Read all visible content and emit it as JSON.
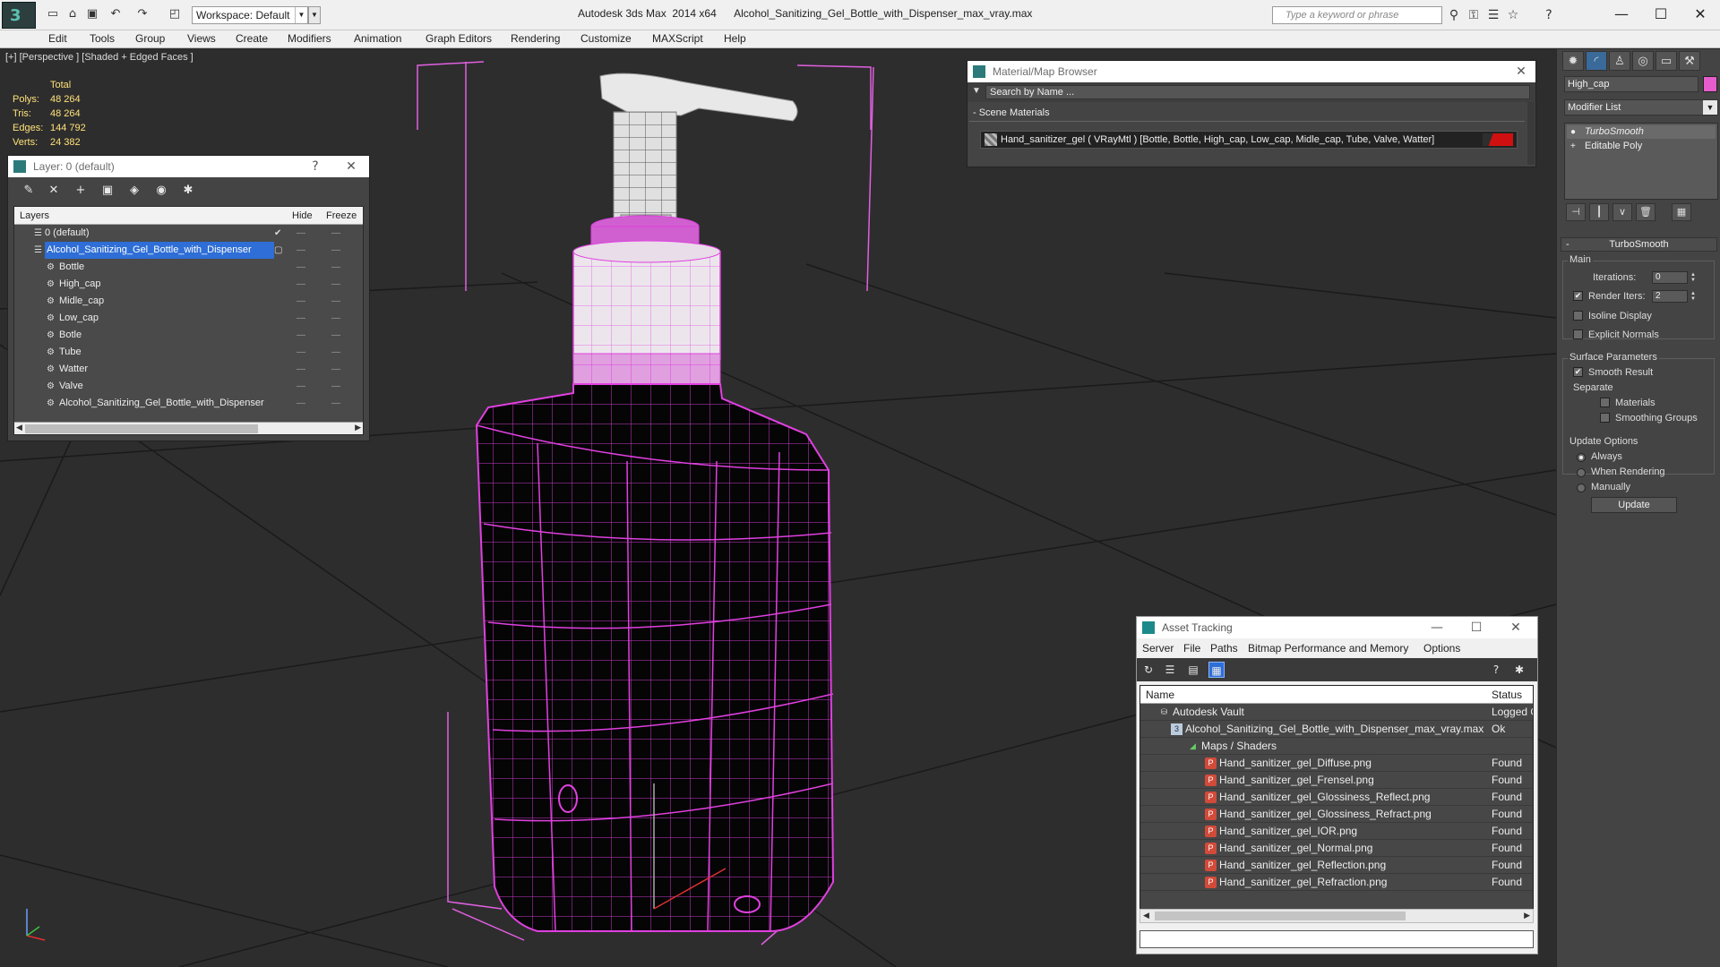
{
  "titlebar": {
    "workspace": "Workspace: Default",
    "app_title": "Autodesk 3ds Max  2014 x64      Alcohol_Sanitizing_Gel_Bottle_with_Dispenser_max_vray.max",
    "search_placeholder": "Type a keyword or phrase"
  },
  "menu": [
    "Edit",
    "Tools",
    "Group",
    "Views",
    "Create",
    "Modifiers",
    "Animation",
    "Graph Editors",
    "Rendering",
    "Customize",
    "MAXScript",
    "Help"
  ],
  "viewport": {
    "label": "[+] [Perspective ] [Shaded + Edged Faces ]",
    "stats": {
      "header": "Total",
      "rows": [
        {
          "k": "Polys:",
          "v": "48 264"
        },
        {
          "k": "Tris:",
          "v": "48 264"
        },
        {
          "k": "Edges:",
          "v": "144 792"
        },
        {
          "k": "Verts:",
          "v": "24 382"
        }
      ]
    }
  },
  "layer_window": {
    "title": "Layer: 0 (default)",
    "help": "?",
    "columns": {
      "layers": "Layers",
      "hide": "Hide",
      "freeze": "Freeze"
    },
    "rows": [
      {
        "name": "0 (default)"
      },
      {
        "name": "Alcohol_Sanitizing_Gel_Bottle_with_Dispenser"
      },
      {
        "name": "Bottle"
      },
      {
        "name": "High_cap"
      },
      {
        "name": "Midle_cap"
      },
      {
        "name": "Low_cap"
      },
      {
        "name": "Botle"
      },
      {
        "name": "Tube"
      },
      {
        "name": "Watter"
      },
      {
        "name": "Valve"
      },
      {
        "name": "Alcohol_Sanitizing_Gel_Bottle_with_Dispenser"
      }
    ]
  },
  "material_browser": {
    "title": "Material/Map Browser",
    "search_placeholder": "Search by Name ...",
    "section": "- Scene Materials",
    "material": "Hand_sanitizer_gel  ( VRayMtl )  [Bottle, Bottle, High_cap, Low_cap, Midle_cap, Tube, Valve, Watter]"
  },
  "command_panel": {
    "object_name": "High_cap",
    "object_color": "#e65ccc",
    "modifier_list": "Modifier List",
    "stack": [
      "TurboSmooth",
      "Editable Poly"
    ],
    "rollout": "TurboSmooth",
    "main_label": "Main",
    "iterations_label": "Iterations:",
    "iterations_value": "0",
    "render_iters_label": "Render Iters:",
    "render_iters_value": "2",
    "isoline": "Isoline Display",
    "explicit_normals": "Explicit Normals",
    "surface_params": "Surface Parameters",
    "smooth_result": "Smooth Result",
    "separate": "Separate",
    "materials": "Materials",
    "smoothing_groups": "Smoothing Groups",
    "update_options": "Update Options",
    "always": "Always",
    "when_rendering": "When Rendering",
    "manually": "Manually",
    "update": "Update"
  },
  "asset_tracking": {
    "title": "Asset Tracking",
    "menu": [
      "Server",
      "File",
      "Paths",
      "Bitmap Performance and Memory",
      "Options"
    ],
    "columns": {
      "name": "Name",
      "status": "Status"
    },
    "rows": [
      {
        "name": "Autodesk Vault",
        "status": "Logged O"
      },
      {
        "name": "Alcohol_Sanitizing_Gel_Bottle_with_Dispenser_max_vray.max",
        "status": "Ok"
      },
      {
        "name": "Maps / Shaders",
        "status": ""
      },
      {
        "name": "Hand_sanitizer_gel_Diffuse.png",
        "status": "Found"
      },
      {
        "name": "Hand_sanitizer_gel_Frensel.png",
        "status": "Found"
      },
      {
        "name": "Hand_sanitizer_gel_Glossiness_Reflect.png",
        "status": "Found"
      },
      {
        "name": "Hand_sanitizer_gel_Glossiness_Refract.png",
        "status": "Found"
      },
      {
        "name": "Hand_sanitizer_gel_IOR.png",
        "status": "Found"
      },
      {
        "name": "Hand_sanitizer_gel_Normal.png",
        "status": "Found"
      },
      {
        "name": "Hand_sanitizer_gel_Reflection.png",
        "status": "Found"
      },
      {
        "name": "Hand_sanitizer_gel_Refraction.png",
        "status": "Found"
      }
    ]
  },
  "colors": {
    "wire": "#e040e0",
    "selection": "#2e6ed6"
  }
}
